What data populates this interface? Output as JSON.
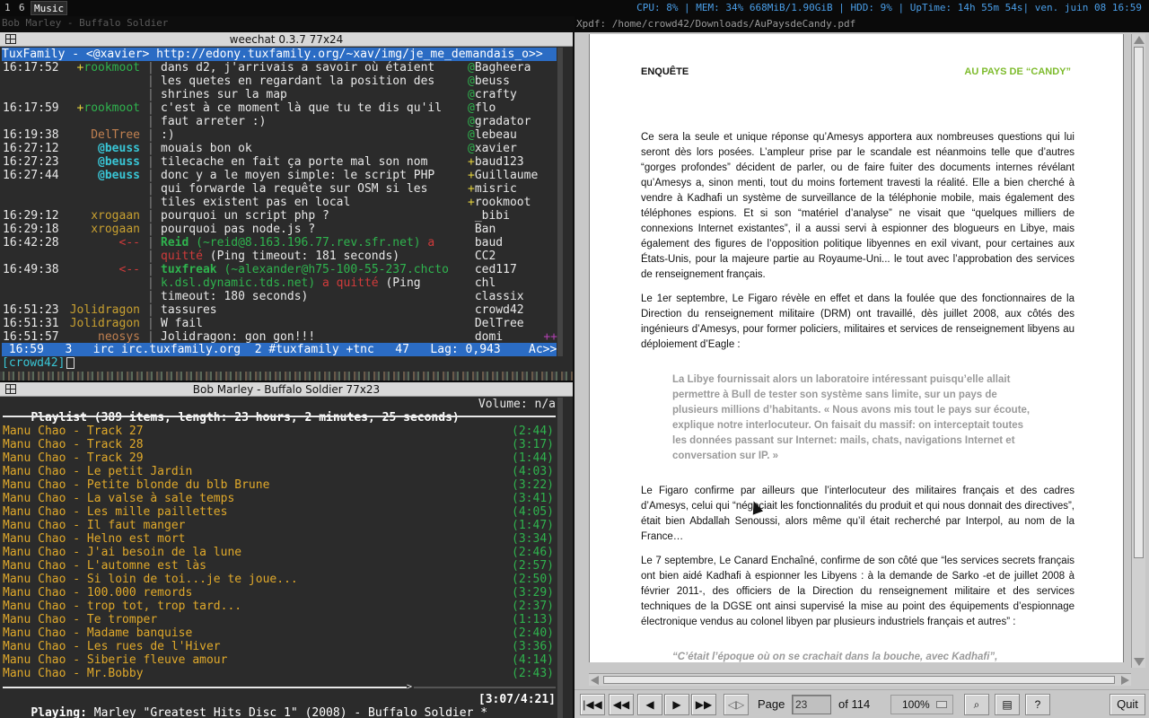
{
  "topbar": {
    "tags": [
      "1",
      "6",
      "Music"
    ],
    "status": "CPU: 8% | MEM:  34% 668MiB/1.90GiB | HDD: 9% | UpTime: 14h 55m 54s| ven. juin 08 16:59"
  },
  "window_title": "Bob Marley - Buffalo Soldier",
  "weechat": {
    "title": "weechat 0.3.7 77x24",
    "topic": "TuxFamily - <@xavier> http://edony.tuxfamily.org/~xav/img/je_me_demandais_o>>",
    "lines": [
      {
        "time": "16:17:52",
        "nick": "+rookmoot",
        "nick_color": "green",
        "msg": "dans d2, j'arrivais a savoir où étaient"
      },
      {
        "time": "",
        "nick": "",
        "nick_color": "",
        "msg": "les quetes en regardant la position des"
      },
      {
        "time": "",
        "nick": "",
        "nick_color": "",
        "msg": "shrines sur la map"
      },
      {
        "time": "16:17:59",
        "nick": "+rookmoot",
        "nick_color": "green",
        "msg": "c'est à ce moment là que tu te dis qu'il"
      },
      {
        "time": "",
        "nick": "",
        "nick_color": "",
        "msg": "faut arreter :)"
      },
      {
        "time": "16:19:38",
        "nick": "DelTree",
        "nick_color": "brown",
        "msg": ":)"
      },
      {
        "time": "16:27:12",
        "nick": "@beuss",
        "nick_color": "cyan",
        "msg": "mouais bon ok"
      },
      {
        "time": "16:27:23",
        "nick": "@beuss",
        "nick_color": "cyan",
        "msg": "tilecache en fait ça porte mal son nom"
      },
      {
        "time": "16:27:44",
        "nick": "@beuss",
        "nick_color": "cyan",
        "msg": "donc y a le moyen simple: le script PHP"
      },
      {
        "time": "",
        "nick": "",
        "nick_color": "",
        "msg": "qui forwarde la requête sur OSM si les"
      },
      {
        "time": "",
        "nick": "",
        "nick_color": "",
        "msg": "tiles existent pas en local"
      },
      {
        "time": "16:29:12",
        "nick": "xrogaan",
        "nick_color": "gold",
        "msg": "pourquoi un script php ?"
      },
      {
        "time": "16:29:18",
        "nick": "xrogaan",
        "nick_color": "gold",
        "msg": "pourquoi pas node.js ?"
      },
      {
        "time": "16:42:28",
        "nick": "<--",
        "nick_color": "red",
        "msg": "",
        "quit_nick": "Reid",
        "quit_host": "(~reid@8.163.196.77.rev.sfr.net)",
        "quit_word": "a"
      },
      {
        "time": "",
        "nick": "",
        "nick_color": "",
        "msg": "",
        "quit_cont1": "quitté",
        "quit_cont2": "(Ping timeout: 181 seconds)"
      },
      {
        "time": "16:49:38",
        "nick": "<--",
        "nick_color": "red",
        "msg": "",
        "quit_nick": "tuxfreak",
        "quit_host": "(~alexander@h75-100-55-237.chcto",
        "quit_word": ""
      },
      {
        "time": "",
        "nick": "",
        "nick_color": "",
        "msg": "",
        "quit_cont3": "k.dsl.dynamic.tds.net)",
        "quit_cont4": "a quitté",
        "quit_cont5": "(Ping"
      },
      {
        "time": "",
        "nick": "",
        "nick_color": "",
        "msg": "timeout: 180 seconds)"
      },
      {
        "time": "16:51:23",
        "nick": "Jolidragon",
        "nick_color": "gold",
        "msg": "tassures"
      },
      {
        "time": "16:51:31",
        "nick": "Jolidragon",
        "nick_color": "gold",
        "msg": "W fail"
      },
      {
        "time": "16:51:57",
        "nick": "neosys",
        "nick_color": "brown",
        "msg": "Jolidragon: gon gon!!!"
      }
    ],
    "nicks": [
      "@Bagheera",
      "@beuss",
      "@crafty",
      "@flo",
      "@gradator",
      "@lebeau",
      "@xavier",
      "+baud123",
      "+Guillaume",
      "+misric",
      "+rookmoot",
      " _bibi",
      " Ban",
      " baud",
      " CC2",
      " ced117",
      " chl",
      " classix",
      " crowd42",
      " DelTree",
      " domi"
    ],
    "nicks_more": "++",
    "status": " 16:59   3   irc irc.tuxfamily.org  2 #tuxfamily +tnc   47   Lag: 0,943    Ac>>",
    "input_nick": "[crowd42]"
  },
  "ncmpc": {
    "title": "Bob Marley - Buffalo Soldier 77x23",
    "header": "Playlist (389 items, length: 23 hours, 2 minutes, 25 seconds)",
    "volume": "Volume: n/a",
    "tracks": [
      {
        "title": "Manu Chao - Track 27",
        "dur": "(2:44)"
      },
      {
        "title": "Manu Chao - Track 28",
        "dur": "(3:17)"
      },
      {
        "title": "Manu Chao - Track 29",
        "dur": "(1:44)"
      },
      {
        "title": "Manu Chao - Le petit Jardin",
        "dur": "(4:03)"
      },
      {
        "title": "Manu Chao - Petite blonde du blb Brune",
        "dur": "(3:22)"
      },
      {
        "title": "Manu Chao - La valse à sale temps",
        "dur": "(3:41)"
      },
      {
        "title": "Manu Chao - Les mille paillettes",
        "dur": "(4:05)"
      },
      {
        "title": "Manu Chao - Il faut manger",
        "dur": "(1:47)"
      },
      {
        "title": "Manu Chao - Helno est mort",
        "dur": "(3:34)"
      },
      {
        "title": "Manu Chao - J'ai besoin de la lune",
        "dur": "(2:46)"
      },
      {
        "title": "Manu Chao - L'automne est làs",
        "dur": "(2:57)"
      },
      {
        "title": "Manu Chao - Si loin de toi...je te joue...",
        "dur": "(2:50)"
      },
      {
        "title": "Manu Chao - 100.000 remords",
        "dur": "(3:29)"
      },
      {
        "title": "Manu Chao - trop tot, trop tard...",
        "dur": "(2:37)"
      },
      {
        "title": "Manu Chao - Te tromper",
        "dur": "(1:13)"
      },
      {
        "title": "Manu Chao - Madame banquise",
        "dur": "(2:40)"
      },
      {
        "title": "Manu Chao - Les rues de l'Hiver",
        "dur": "(3:36)"
      },
      {
        "title": "Manu Chao - Siberie fleuve amour",
        "dur": "(4:14)"
      },
      {
        "title": "Manu Chao - Mr.Bobby",
        "dur": "(2:43)"
      }
    ],
    "progress_fraction": 0.73,
    "playing_label": "Playing:",
    "playing_text": " Marley \"Greatest Hits Disc 1\" (2008) - Buffalo Soldier *",
    "playing_time": "[3:07/4:21]"
  },
  "xpdf": {
    "title": "Xpdf: /home/crowd42/Downloads/AuPaysdeCandy.pdf",
    "header_left": "ENQUÊTE",
    "header_right": "AU PAYS DE “CANDY”",
    "p1": "Ce sera la seule et unique réponse qu’Amesys apportera aux nombreuses questions qui lui seront dès lors posées. L’ampleur prise par le scandale est néanmoins telle que d’autres “gorges profondes” décident de parler, ou de faire fuiter des documents internes révélant qu’Amesys a, sinon menti, tout du moins fortement travesti la réalité. Elle a bien cherché à vendre à Kadhafi un système de surveillance de la téléphonie mobile, mais également des téléphones espions. Et si son “matériel d’analyse” ne visait que “quelques milliers de connexions Internet existantes”, il a aussi servi à espionner des blogueurs en Libye, mais également des figures de l’opposition politique libyennes en exil vivant, pour certaines aux États-Unis, pour la majeure partie au Royaume-Uni... le tout avec l’approbation des services de renseignement français.",
    "p2": "Le 1er septembre, Le Figaro révèle en effet et dans la foulée que des fonctionnaires de la Direction du renseignement militaire (DRM) ont travaillé, dès juillet 2008, aux côtés des ingénieurs d’Amesys, pour former policiers, militaires et services de renseignement libyens au déploiement d’Eagle :",
    "quote1": "La Libye fournissait alors un laboratoire intéressant puisqu’elle allait permettre à Bull de tester son système sans limite, sur un pays de plusieurs millions d’habitants. « Nous avons mis tout le pays sur écoute, explique notre interlocuteur. On faisait du massif: on interceptait toutes les données passant sur Internet: mails, chats, navigations Internet et conversation sur IP. »",
    "p3": "Le Figaro confirme par ailleurs que l’interlocuteur des militaires français et des cadres d’Amesys, celui qui “négociait les fonctionnalités du produit et qui nous donnait des directives”, était bien Abdallah Senoussi, alors même qu’il était recherché par Interpol, au nom de la France…",
    "p4": "Le 7 septembre, Le Canard Enchaîné, confirme de son côté que “les services secrets français ont bien aidé Kadhafi à espionner les Libyens : à la demande de Sarko -et de juillet 2008 à février 2011-, des officiers de la Direction du renseignement militaire et des services techniques de la DGSE ont ainsi supervisé la mise au point des équipements d’espionnage électronique vendus au colonel libyen par plusieurs industriels français et autres” :",
    "quote2": "“C’était l’époque où on se crachait dans la bouche, avec Kadhafi”,",
    "toolbar": {
      "page_label": "Page",
      "page_value": "23",
      "of_label": "of 114",
      "zoom": "100%",
      "quit": "Quit",
      "help": "?"
    }
  }
}
